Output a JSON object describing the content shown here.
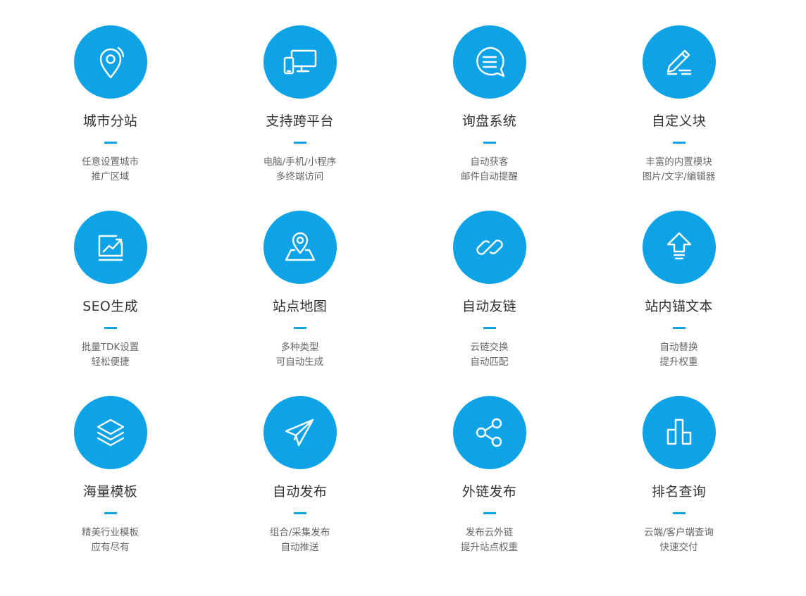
{
  "colors": {
    "accent": "#0ea3e7",
    "title_text": "#333333",
    "desc_text": "#666666"
  },
  "features": [
    {
      "icon": "map-pin-icon",
      "title": "城市分站",
      "desc": [
        "任意设置城市",
        "推广区域"
      ]
    },
    {
      "icon": "devices-icon",
      "title": "支持跨平台",
      "desc": [
        "电脑/手机/小程序",
        "多终端访问"
      ]
    },
    {
      "icon": "chat-bubble-icon",
      "title": "询盘系统",
      "desc": [
        "自动获客",
        "邮件自动提醒"
      ]
    },
    {
      "icon": "pencil-icon",
      "title": "自定义块",
      "desc": [
        "丰富的内置模块",
        "图片/文字/编辑器"
      ]
    },
    {
      "icon": "trend-chart-icon",
      "title": "SEO生成",
      "desc": [
        "批量TDK设置",
        "轻松便捷"
      ]
    },
    {
      "icon": "map-location-icon",
      "title": "站点地图",
      "desc": [
        "多种类型",
        "可自动生成"
      ]
    },
    {
      "icon": "link-icon",
      "title": "自动友链",
      "desc": [
        "云链交换",
        "自动匹配"
      ]
    },
    {
      "icon": "upload-arrow-icon",
      "title": "站内锚文本",
      "desc": [
        "自动替换",
        "提升权重"
      ]
    },
    {
      "icon": "layers-icon",
      "title": "海量模板",
      "desc": [
        "精美行业模板",
        "应有尽有"
      ]
    },
    {
      "icon": "paper-plane-icon",
      "title": "自动发布",
      "desc": [
        "组合/采集发布",
        "自动推送"
      ]
    },
    {
      "icon": "share-icon",
      "title": "外链发布",
      "desc": [
        "发布云外链",
        "提升站点权重"
      ]
    },
    {
      "icon": "bar-chart-icon",
      "title": "排名查询",
      "desc": [
        "云端/客户端查询",
        "快速交付"
      ]
    }
  ]
}
